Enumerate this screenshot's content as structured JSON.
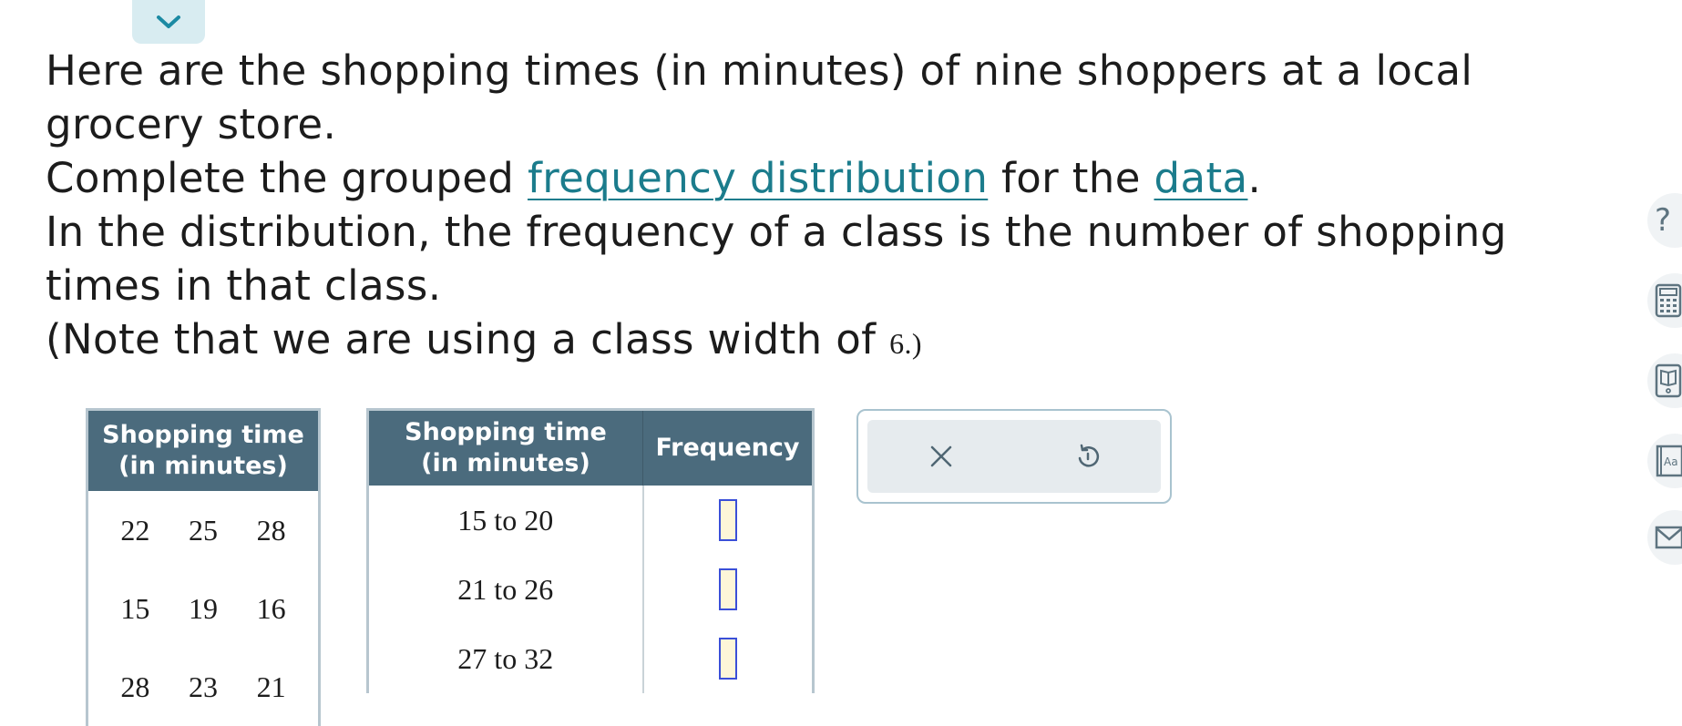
{
  "collapse_icon": "chevron-down-icon",
  "prompt": {
    "line1": "Here are the shopping times (in minutes) of nine shoppers at a local grocery store.",
    "line2_pre": "Complete the grouped ",
    "link_frequency_distribution": "frequency distribution",
    "line2_mid": " for the ",
    "link_data": "data",
    "line2_post": ".",
    "line3": "In the distribution, the frequency of a class is the number of shopping times in that class.",
    "line4_pre": "(Note that we are using a class width of ",
    "class_width": "6.)"
  },
  "data_table": {
    "header_line1": "Shopping time",
    "header_line2": "(in minutes)",
    "rows": [
      [
        "22",
        "25",
        "28"
      ],
      [
        "15",
        "19",
        "16"
      ],
      [
        "28",
        "23",
        "21"
      ]
    ]
  },
  "freq_table": {
    "header_time_line1": "Shopping time",
    "header_time_line2": "(in minutes)",
    "header_frequency": "Frequency",
    "rows": [
      {
        "lo": "15",
        "sep": "to",
        "hi": "20",
        "frequency": ""
      },
      {
        "lo": "21",
        "sep": "to",
        "hi": "26",
        "frequency": ""
      },
      {
        "lo": "27",
        "sep": "to",
        "hi": "32",
        "frequency": ""
      }
    ]
  },
  "actions": {
    "clear_icon": "close-icon",
    "undo_icon": "undo-icon"
  },
  "side_tools": [
    "help-icon",
    "calculator-icon",
    "ebook-icon",
    "glossary-icon",
    "mail-icon"
  ],
  "colors": {
    "header_bg": "#4b6b7d",
    "link": "#1b7c8c",
    "input_border": "#3a4fd8",
    "input_fill": "#fdf6d8",
    "tab_bg": "#d8ecf1"
  }
}
